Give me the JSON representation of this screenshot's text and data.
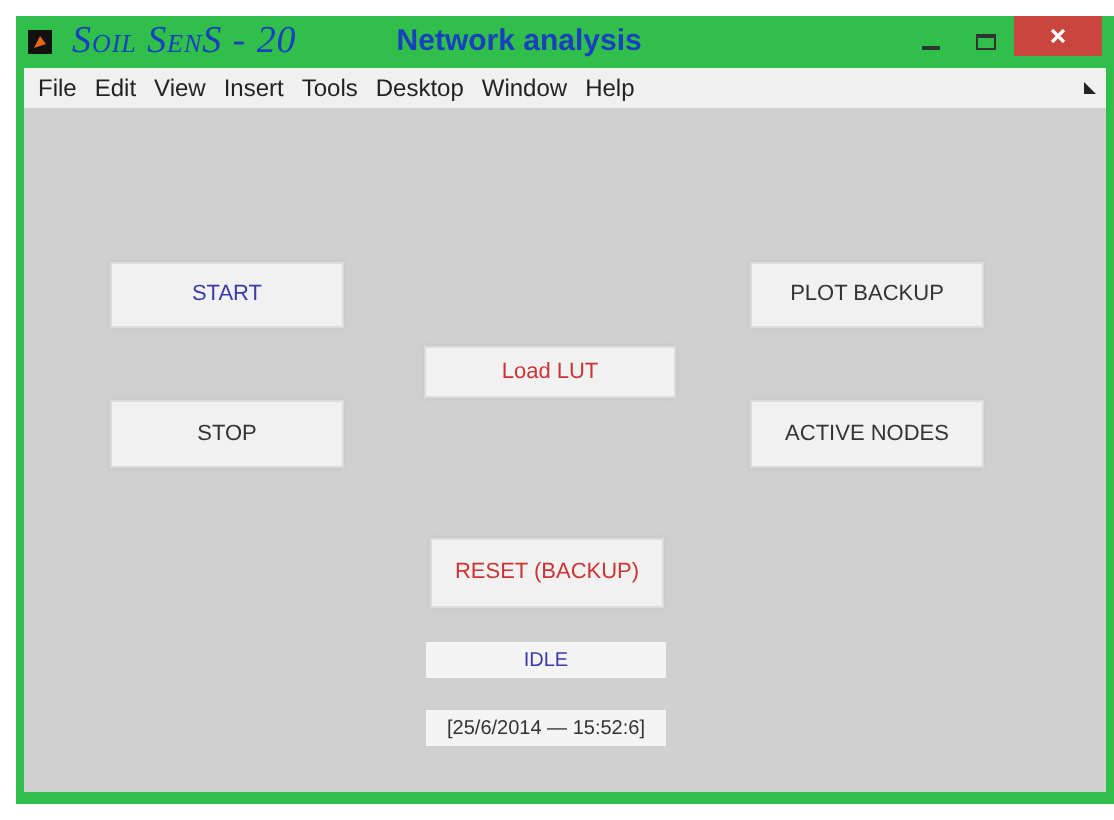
{
  "window": {
    "app_name": "Soil SenS - 20",
    "title": "Network analysis"
  },
  "menu": [
    "File",
    "Edit",
    "View",
    "Insert",
    "Tools",
    "Desktop",
    "Window",
    "Help"
  ],
  "controls": [
    {
      "kind": "button",
      "label": "START",
      "color": "#3a3aa8"
    },
    {
      "kind": "button",
      "label": "STOP",
      "color": "#333333"
    },
    {
      "kind": "button",
      "label": "Load LUT",
      "color": "#cc3333"
    },
    {
      "kind": "button",
      "label": "PLOT BACKUP",
      "color": "#333333"
    },
    {
      "kind": "button",
      "label": "ACTIVE NODES",
      "color": "#333333"
    },
    {
      "kind": "button",
      "label": "RESET (BACKUP)",
      "color": "#cc3333"
    },
    {
      "kind": "label",
      "label": "IDLE",
      "color": "#3a3aa8"
    },
    {
      "kind": "label",
      "label": "[25/6/2014 — 15:52:6]",
      "color": "#333333"
    }
  ]
}
